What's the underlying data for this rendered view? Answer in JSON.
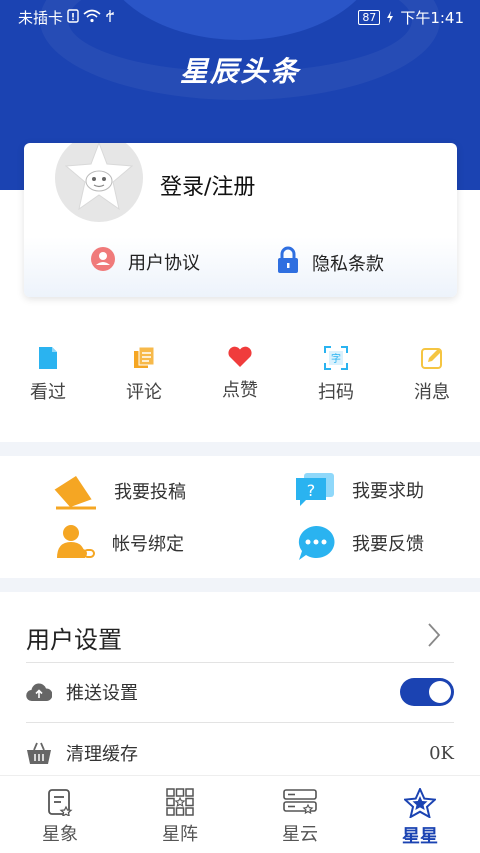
{
  "status_bar": {
    "carrier": "未插卡",
    "battery": "87",
    "time": "下午1:41"
  },
  "header": {
    "logo": "星辰头条"
  },
  "profile": {
    "login_label": "登录/注册",
    "user_agreement": "用户协议",
    "privacy_policy": "隐私条款"
  },
  "quick_actions": [
    {
      "label": "看过",
      "icon": "file-icon",
      "color": "#2ab3f0"
    },
    {
      "label": "评论",
      "icon": "document-icon",
      "color": "#f5a623"
    },
    {
      "label": "点赞",
      "icon": "heart-icon",
      "color": "#f03c3c"
    },
    {
      "label": "扫码",
      "icon": "scan-icon",
      "color": "#2ab3f0"
    },
    {
      "label": "消息",
      "icon": "edit-icon",
      "color": "#f5c542"
    }
  ],
  "actions": {
    "submit": "我要投稿",
    "help": "我要求助",
    "bind": "帐号绑定",
    "feedback": "我要反馈"
  },
  "settings": {
    "title": "用户设置",
    "push_label": "推送设置",
    "push_enabled": true,
    "cache_label": "清理缓存",
    "cache_value": "0K"
  },
  "tabs": [
    {
      "label": "星象",
      "icon": "news-icon",
      "active": false
    },
    {
      "label": "星阵",
      "icon": "grid-icon",
      "active": false
    },
    {
      "label": "星云",
      "icon": "server-icon",
      "active": false
    },
    {
      "label": "星星",
      "icon": "star-icon",
      "active": true
    }
  ],
  "colors": {
    "brand": "#1b43b2",
    "separator": "#f1f4f9"
  }
}
